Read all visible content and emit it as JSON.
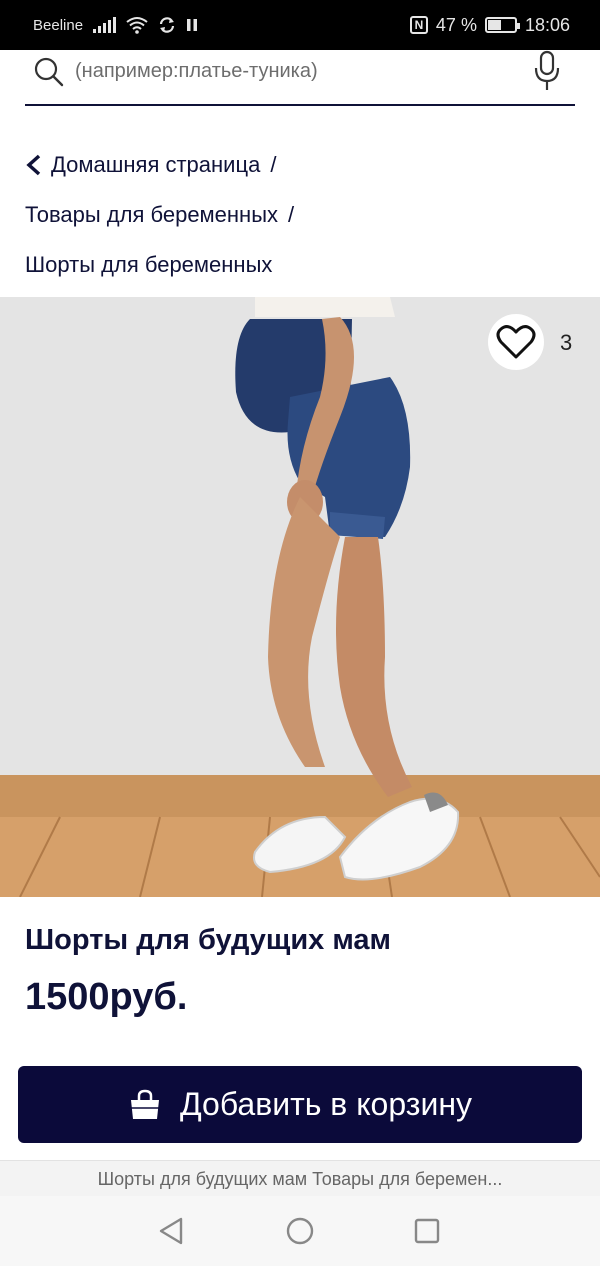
{
  "status_bar": {
    "carrier": "Beeline",
    "battery_percent": "47 %",
    "time": "18:06",
    "icons": [
      "signal-icon",
      "wifi-icon",
      "sync-icon",
      "pause-icon",
      "nfc-icon",
      "battery-icon"
    ]
  },
  "search": {
    "placeholder": "(например:платье-туника)",
    "icon": "search-icon",
    "mic_icon": "microphone-icon"
  },
  "breadcrumbs": [
    {
      "label": "Домашняя страница",
      "separator": "/"
    },
    {
      "label": "Товары для беременных",
      "separator": "/"
    },
    {
      "label": "Шорты для беременных",
      "separator": ""
    }
  ],
  "product": {
    "favorites_count": "3",
    "arrow_prev": "←",
    "arrow_next": "→",
    "title": "Шорты для будущих мам",
    "price": "1500руб."
  },
  "cart_button": {
    "label": "Добавить в корзину",
    "icon": "shopping-bag-icon",
    "background": "#0b0a3a"
  },
  "related_strip": {
    "text": "Шорты для будущих мам Товары для беремен..."
  },
  "nav_bar": {
    "icons": [
      "back-triangle-icon",
      "home-circle-icon",
      "recents-square-icon"
    ]
  },
  "colors": {
    "text": "#0f1238",
    "accent": "#0b0a3a"
  }
}
